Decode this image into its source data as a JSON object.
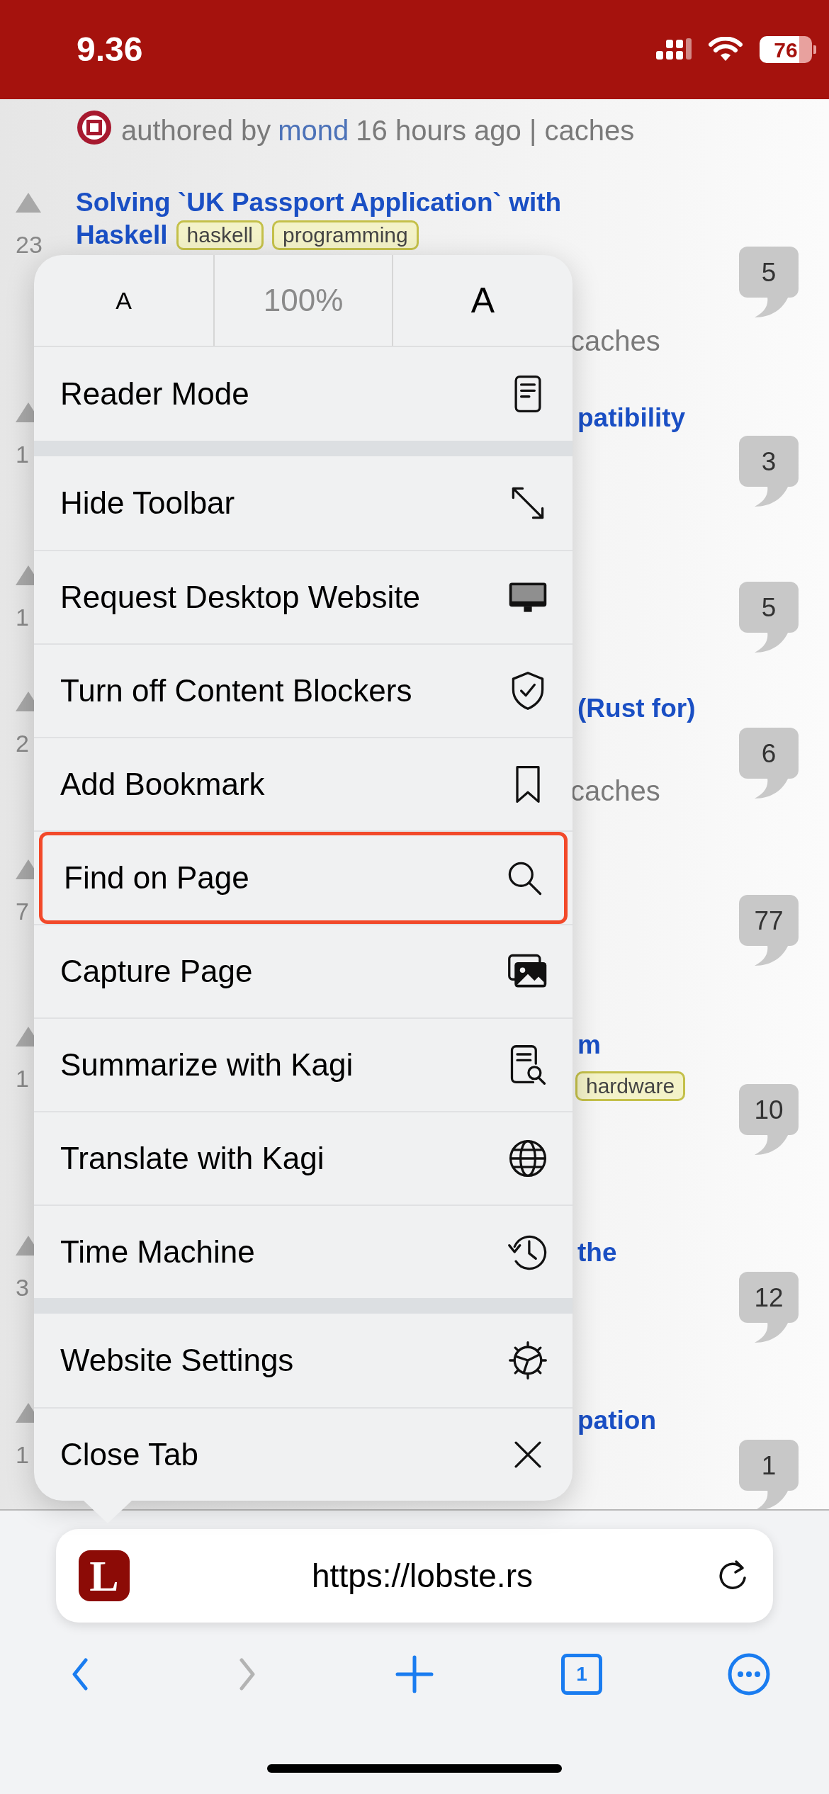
{
  "status_bar": {
    "time": "9.36",
    "battery": "76"
  },
  "page": {
    "byline": {
      "prefix": "authored by",
      "author": "mond",
      "suffix": "16 hours ago | caches"
    },
    "stories": [
      {
        "score": "23",
        "title_lines": [
          "Solving `UK Passport Application` with",
          "Haskell"
        ],
        "tags": [
          "haskell",
          "programming"
        ],
        "meta": "caches",
        "comments": "5"
      },
      {
        "score": "1",
        "title_lines": [
          "patibility"
        ],
        "comments": "3"
      },
      {
        "score": "1",
        "comments": "5"
      },
      {
        "score": "2",
        "title_lines": [
          "(Rust for)"
        ],
        "meta": "caches",
        "comments": "6"
      },
      {
        "score": "7",
        "comments": "77"
      },
      {
        "score": "1",
        "title_lines": [
          "m"
        ],
        "tags": [
          "hardware"
        ],
        "comments": "10"
      },
      {
        "score": "3",
        "title_lines": [
          "the"
        ],
        "comments": "12"
      },
      {
        "score": "1",
        "title_lines": [
          "pation"
        ],
        "comments": "1"
      }
    ]
  },
  "menu": {
    "text_size": {
      "smaller": "A",
      "zoom": "100%",
      "larger": "A"
    },
    "groups": [
      [
        {
          "label": "Reader Mode",
          "highlighted": false
        }
      ],
      [
        {
          "label": "Hide Toolbar",
          "highlighted": false
        },
        {
          "label": "Request Desktop Website",
          "highlighted": false
        },
        {
          "label": "Turn off Content Blockers",
          "highlighted": false
        },
        {
          "label": "Add Bookmark",
          "highlighted": false
        },
        {
          "label": "Find on Page",
          "highlighted": true
        },
        {
          "label": "Capture Page",
          "highlighted": false
        },
        {
          "label": "Summarize with Kagi",
          "highlighted": false
        },
        {
          "label": "Translate with Kagi",
          "highlighted": false
        },
        {
          "label": "Time Machine",
          "highlighted": false
        }
      ],
      [
        {
          "label": "Website Settings",
          "highlighted": false
        },
        {
          "label": "Close Tab",
          "highlighted": false
        }
      ]
    ]
  },
  "address_bar": {
    "favicon": "L",
    "url": "https://lobste.rs"
  },
  "toolbar": [
    {
      "kind": "back",
      "disabled": false
    },
    {
      "kind": "forward",
      "disabled": true
    },
    {
      "kind": "new-tab",
      "disabled": false
    },
    {
      "kind": "tabs",
      "count": "1",
      "disabled": false
    },
    {
      "kind": "more",
      "disabled": false
    }
  ]
}
